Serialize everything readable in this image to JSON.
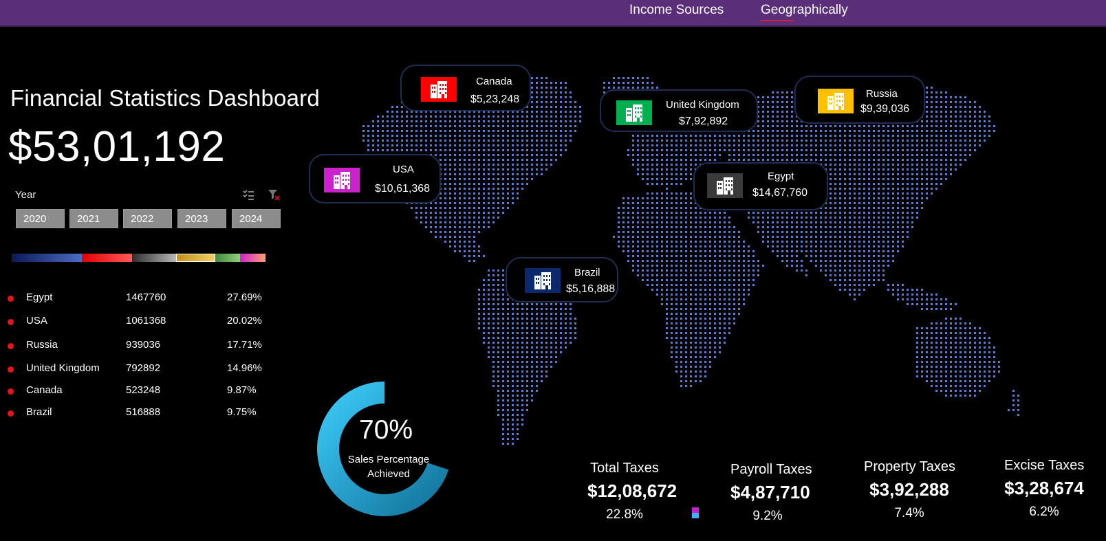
{
  "nav": {
    "tabs": [
      {
        "label": "Income Sources"
      },
      {
        "label": "Geographically"
      }
    ]
  },
  "dashboard": {
    "title": "Financial Statistics Dashboard",
    "total": "$53,01,192"
  },
  "slicer": {
    "label": "Year",
    "icons": [
      "multi-select-icon",
      "clear-filter-icon"
    ],
    "years": [
      "2020",
      "2021",
      "2022",
      "2023",
      "2024"
    ]
  },
  "colors": {
    "accent_purple": "#5a2e78",
    "dot_red": "#e0161c",
    "map_dots": "#5b7fd9",
    "donut_start": "#3fd0ff",
    "donut_end": "#0f6e95"
  },
  "country_table": {
    "rows": [
      {
        "country": "Egypt",
        "value": "1467760",
        "pct": "27.69%"
      },
      {
        "country": "USA",
        "value": "1061368",
        "pct": "20.02%"
      },
      {
        "country": "Russia",
        "value": "939036",
        "pct": "17.71%"
      },
      {
        "country": "United Kingdom",
        "value": "792892",
        "pct": "14.96%"
      },
      {
        "country": "Canada",
        "value": "523248",
        "pct": "9.87%"
      },
      {
        "country": "Brazil",
        "value": "516888",
        "pct": "9.75%"
      }
    ]
  },
  "map_cards": [
    {
      "name": "Canada",
      "value": "$5,23,248",
      "icon": "building-icon",
      "color": "#ff0000"
    },
    {
      "name": "United Kingdom",
      "value": "$7,92,892",
      "icon": "building-icon",
      "color": "#00b050"
    },
    {
      "name": "Russia",
      "value": "$9,39,036",
      "icon": "building-icon",
      "color": "#ffc000"
    },
    {
      "name": "USA",
      "value": "$10,61,368",
      "icon": "building-icon",
      "color": "#cc22cc"
    },
    {
      "name": "Egypt",
      "value": "$14,67,760",
      "icon": "building-icon",
      "color": "#3a3a3a"
    },
    {
      "name": "Brazil",
      "value": "$5,16,888",
      "icon": "building-icon",
      "color": "#0b2a6e"
    }
  ],
  "donut": {
    "percent_value": 70,
    "percent_text": "70%",
    "label": "Sales Percentage Achieved"
  },
  "taxes": [
    {
      "label": "Total Taxes",
      "value": "$12,08,672",
      "pct": "22.8%"
    },
    {
      "label": "Payroll Taxes",
      "value": "$4,87,710",
      "pct": "9.2%"
    },
    {
      "label": "Property Taxes",
      "value": "$3,92,288",
      "pct": "7.4%"
    },
    {
      "label": "Excise Taxes",
      "value": "$3,28,674",
      "pct": "6.2%"
    }
  ]
}
